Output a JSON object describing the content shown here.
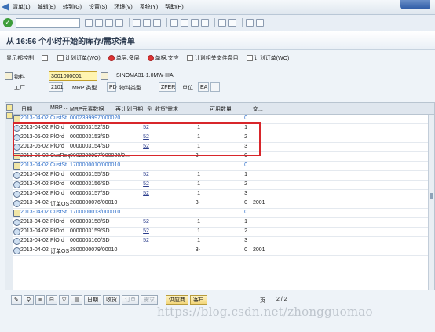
{
  "menu": {
    "items": [
      "清单(L)",
      "编辑(E)",
      "转到(G)",
      "设置(S)",
      "环境(V)",
      "系统(Y)",
      "帮助(H)"
    ]
  },
  "title": "从 16:56 个小时开始的库存/需求清单",
  "app_toolbar": {
    "buttons": [
      "显示都控制",
      "",
      "计划订单(WO)",
      "单层,多层",
      "单据,文应",
      "计划相关文件条目",
      "计划订单(WO)"
    ]
  },
  "header": {
    "material_label": "物料",
    "material_value": "3001000001",
    "material_desc": "SINOMA31-1.0MW-IIIA",
    "plant_label": "工厂",
    "plant_value": "2101",
    "mrp_type_label": "MRP 类型",
    "mrp_type_value": "PD",
    "material_type_label": "物料类型",
    "material_type_value": "ZFER",
    "unit_label": "单位",
    "unit_value": "EA"
  },
  "table": {
    "columns": [
      "日期",
      "MRP ...",
      "MRP元素数据",
      "再计划日期",
      "例",
      "收货/需求",
      "可用数量",
      "交..."
    ],
    "rows": [
      {
        "date": "2013-04-02",
        "mrp": "CustSt",
        "element": "0002399997/000020",
        "dd": "",
        "qty": "",
        "avail": "0",
        "stor": "",
        "style": "blue"
      },
      {
        "date": "2013-04-02",
        "mrp": "PlOrd",
        "element": "0000003152/SD",
        "dd": "52",
        "qty": "1",
        "avail": "1",
        "stor": "",
        "style": ""
      },
      {
        "date": "2013-05-02",
        "mrp": "PlOrd",
        "element": "0000003153/SD",
        "dd": "52",
        "qty": "1",
        "avail": "2",
        "stor": "",
        "style": ""
      },
      {
        "date": "2013-05-02",
        "mrp": "PlOrd",
        "element": "0000003154/SD",
        "dd": "52",
        "qty": "1",
        "avail": "3",
        "stor": "",
        "style": ""
      },
      {
        "date": "2013-05-02",
        "mrp": "CusReq",
        "element": "0002399997/000020/0...",
        "dd": "",
        "qty": "3-",
        "avail": "0",
        "stor": "",
        "style": ""
      },
      {
        "date": "2013-04-02",
        "mrp": "CustSt",
        "element": "1700000010/000010",
        "dd": "",
        "qty": "",
        "avail": "0",
        "stor": "",
        "style": "blue"
      },
      {
        "date": "2013-04-02",
        "mrp": "PlOrd",
        "element": "0000003155/SD",
        "dd": "52",
        "qty": "1",
        "avail": "1",
        "stor": "",
        "style": ""
      },
      {
        "date": "2013-04-02",
        "mrp": "PlOrd",
        "element": "0000003156/SD",
        "dd": "52",
        "qty": "1",
        "avail": "2",
        "stor": "",
        "style": ""
      },
      {
        "date": "2013-04-02",
        "mrp": "PlOrd",
        "element": "0000003157/SD",
        "dd": "52",
        "qty": "1",
        "avail": "3",
        "stor": "",
        "style": ""
      },
      {
        "date": "2013-04-02",
        "mrp": "订单OS",
        "element": "2800000076/00010",
        "dd": "",
        "qty": "3-",
        "avail": "0",
        "stor": "2001",
        "style": ""
      },
      {
        "date": "2013-04-02",
        "mrp": "CustSt",
        "element": "1700000013/000010",
        "dd": "",
        "qty": "",
        "avail": "0",
        "stor": "",
        "style": "blue"
      },
      {
        "date": "2013-04-02",
        "mrp": "PlOrd",
        "element": "0000003158/SD",
        "dd": "52",
        "qty": "1",
        "avail": "1",
        "stor": "",
        "style": ""
      },
      {
        "date": "2013-04-02",
        "mrp": "PlOrd",
        "element": "0000003159/SD",
        "dd": "52",
        "qty": "1",
        "avail": "2",
        "stor": "",
        "style": ""
      },
      {
        "date": "2013-04-02",
        "mrp": "PlOrd",
        "element": "0000003160/SD",
        "dd": "52",
        "qty": "1",
        "avail": "3",
        "stor": "",
        "style": ""
      },
      {
        "date": "2013-04-02",
        "mrp": "订单OS",
        "element": "2800000079/00010",
        "dd": "",
        "qty": "3-",
        "avail": "0",
        "stor": "2001",
        "style": ""
      }
    ]
  },
  "footer": {
    "buttons": [
      "日期",
      "收货",
      "订单",
      "需求",
      "供应商",
      "客户"
    ],
    "page_label": "页",
    "page_value": "2 / 2"
  },
  "watermark": "https://blog.csdn.net/zhongguomao"
}
